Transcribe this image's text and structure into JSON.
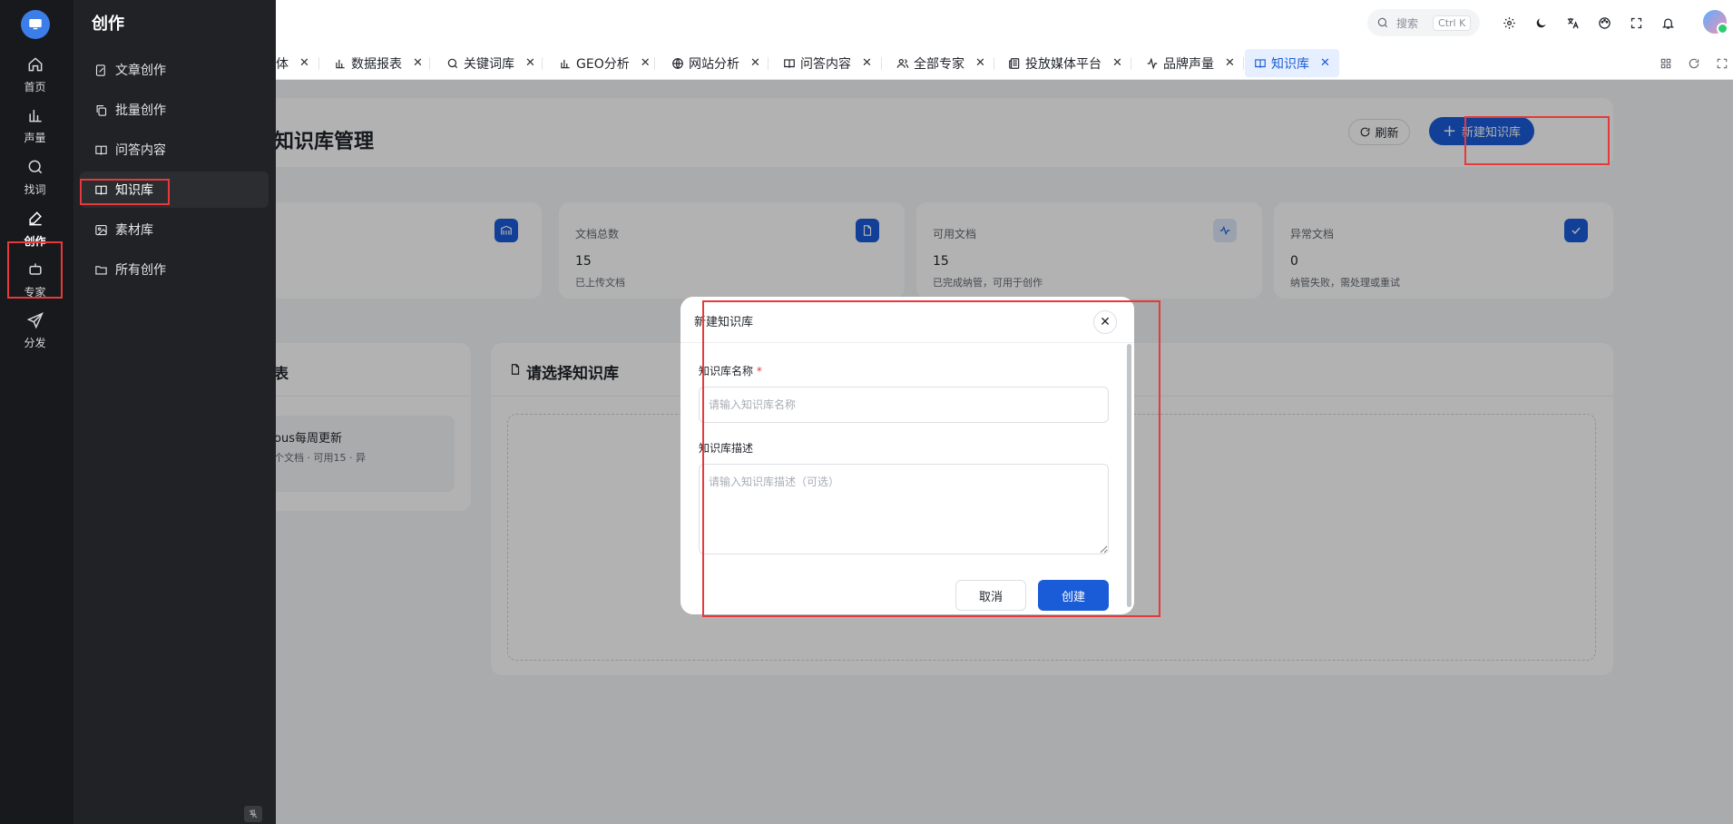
{
  "rail": {
    "items": [
      {
        "label": "首页",
        "icon": "home-icon"
      },
      {
        "label": "声量",
        "icon": "bar-chart-icon"
      },
      {
        "label": "找词",
        "icon": "search-icon"
      },
      {
        "label": "创作",
        "icon": "edit-icon"
      },
      {
        "label": "专家",
        "icon": "robot-icon"
      },
      {
        "label": "分发",
        "icon": "send-icon"
      }
    ],
    "active": "创作"
  },
  "submenu": {
    "title": "创作",
    "items": [
      {
        "label": "文章创作",
        "icon": "edit-doc-icon"
      },
      {
        "label": "批量创作",
        "icon": "copy-icon"
      },
      {
        "label": "问答内容",
        "icon": "book-icon"
      },
      {
        "label": "知识库",
        "icon": "book-open-icon"
      },
      {
        "label": "素材库",
        "icon": "image-icon"
      },
      {
        "label": "所有创作",
        "icon": "folder-icon"
      }
    ],
    "active": "知识库"
  },
  "topbar": {
    "search_label": "搜索",
    "search_shortcut": "Ctrl K"
  },
  "tabs": [
    {
      "label": "体",
      "icon": ""
    },
    {
      "label": "数据报表",
      "icon": "bar-chart-icon"
    },
    {
      "label": "关键词库",
      "icon": "search-icon"
    },
    {
      "label": "GEO分析",
      "icon": "bar-chart-icon"
    },
    {
      "label": "网站分析",
      "icon": "globe-icon"
    },
    {
      "label": "问答内容",
      "icon": "book-icon"
    },
    {
      "label": "全部专家",
      "icon": "users-icon"
    },
    {
      "label": "投放媒体平台",
      "icon": "news-icon"
    },
    {
      "label": "品牌声量",
      "icon": "activity-icon"
    },
    {
      "label": "知识库",
      "icon": "book-open-icon"
    }
  ],
  "page": {
    "title": "知识库管理",
    "refresh_label": "刷新",
    "new_label": "新建知识库",
    "list_title_fragment": "表",
    "kb_item_name_fragment": "ous每周更新",
    "kb_item_meta_fragment": "个文档 · 可用15 · 异",
    "detail_title": "请选择知识库"
  },
  "stats": [
    {
      "label": "文档总数",
      "value": "15",
      "desc": "已上传文档",
      "icon": "file-icon"
    },
    {
      "label": "可用文档",
      "value": "15",
      "desc": "已完成纳管，可用于创作",
      "icon": "pulse-icon"
    },
    {
      "label": "异常文档",
      "value": "0",
      "desc": "纳管失败，需处理或重试",
      "icon": "check-icon"
    }
  ],
  "dialog": {
    "title": "新建知识库",
    "name_label": "知识库名称",
    "name_required": "*",
    "name_placeholder": "请输入知识库名称",
    "desc_label": "知识库描述",
    "desc_placeholder": "请输入知识库描述（可选）",
    "cancel_label": "取消",
    "create_label": "创建",
    "close_glyph": "✕"
  },
  "colors": {
    "primary": "#1a5bd8",
    "highlight_border": "#e5393b",
    "rail_bg": "#18191c",
    "submenu_bg": "#212225"
  }
}
